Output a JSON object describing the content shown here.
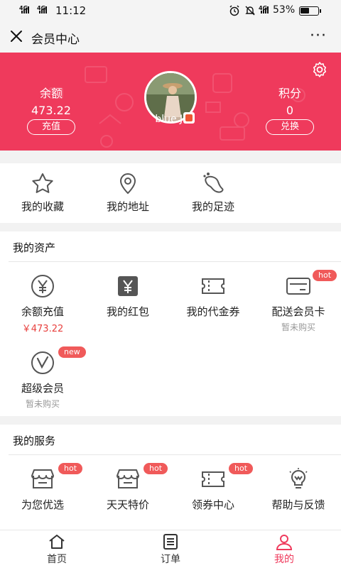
{
  "status_bar": {
    "signal_1": "4G",
    "signal_2": "4G",
    "time": "11:12",
    "net": "4G",
    "battery": "53%",
    "battery_level": 0.53
  },
  "titlebar": {
    "title": "会员中心",
    "more": "···"
  },
  "header": {
    "balance_label": "余额",
    "balance_value": "473.22",
    "recharge_button": "充值",
    "points_label": "积分",
    "points_value": "0",
    "exchange_button": "兑换",
    "username": "blue J.",
    "bg_color": "#ef3a5c"
  },
  "quick_links": [
    {
      "label": "我的收藏",
      "icon": "star-icon"
    },
    {
      "label": "我的地址",
      "icon": "location-pin-icon"
    },
    {
      "label": "我的足迹",
      "icon": "footprint-icon"
    }
  ],
  "assets": {
    "title": "我的资产",
    "items": [
      {
        "label": "余额充值",
        "sub": "￥473.22",
        "icon": "yen-circle-icon",
        "tag": ""
      },
      {
        "label": "我的红包",
        "sub": "",
        "icon": "red-packet-icon",
        "tag": ""
      },
      {
        "label": "我的代金券",
        "sub": "",
        "icon": "voucher-icon",
        "tag": ""
      },
      {
        "label": "配送会员卡",
        "sub": "暂未购买",
        "icon": "card-icon",
        "tag": "hot"
      },
      {
        "label": "超级会员",
        "sub": "暂未购买",
        "icon": "super-member-icon",
        "tag": "new"
      }
    ]
  },
  "services": {
    "title": "我的服务",
    "items": [
      {
        "label": "为您优选",
        "icon": "store-icon",
        "tag": "hot"
      },
      {
        "label": "天天特价",
        "icon": "store-icon",
        "tag": "hot"
      },
      {
        "label": "领券中心",
        "icon": "ticket-icon",
        "tag": "hot"
      },
      {
        "label": "帮助与反馈",
        "icon": "lightbulb-icon",
        "tag": ""
      }
    ]
  },
  "tabbar": {
    "items": [
      {
        "label": "首页",
        "icon": "home-icon"
      },
      {
        "label": "订单",
        "icon": "order-list-icon"
      },
      {
        "label": "我的",
        "icon": "user-icon"
      }
    ],
    "active_index": 2,
    "active_color": "#ef3a5c"
  }
}
